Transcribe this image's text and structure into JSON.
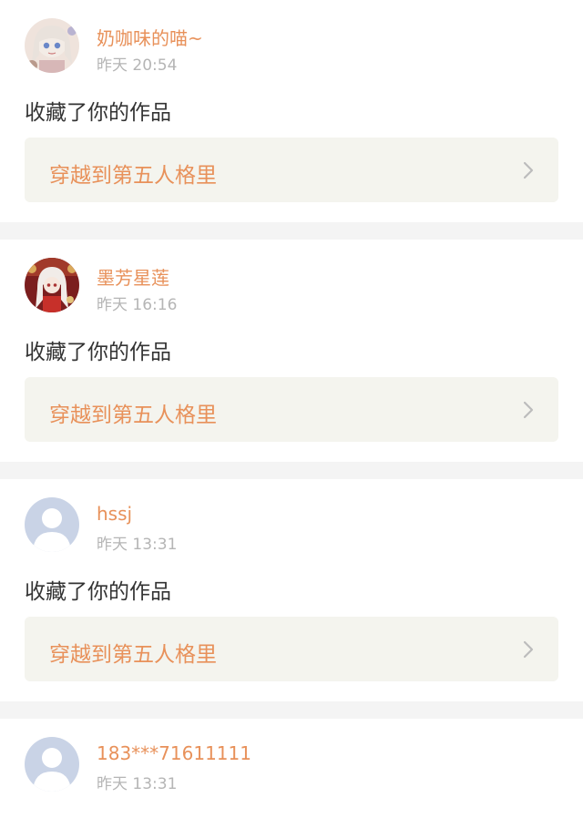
{
  "notifications": [
    {
      "user_name": "奶咖味的喵~",
      "time": "昨天 20:54",
      "action": "收藏了你的作品",
      "work_title": "穿越到第五人格里",
      "avatar": "anime-girl-white-hair"
    },
    {
      "user_name": "墨芳星莲",
      "time": "昨天 16:16",
      "action": "收藏了你的作品",
      "work_title": "穿越到第五人格里",
      "avatar": "anime-girl-red-outfit"
    },
    {
      "user_name": "hssj",
      "time": "昨天 13:31",
      "action": "收藏了你的作品",
      "work_title": "穿越到第五人格里",
      "avatar": "default-user"
    },
    {
      "user_name": "183***71611111",
      "time": "昨天 13:31",
      "avatar": "default-user"
    }
  ],
  "colors": {
    "accent": "#e8915a",
    "time": "#b5b5b5",
    "body_text": "#333333",
    "link_bg": "#f4f4ee",
    "divider": "#f4f4f4",
    "default_avatar": "#c9d3e6"
  }
}
